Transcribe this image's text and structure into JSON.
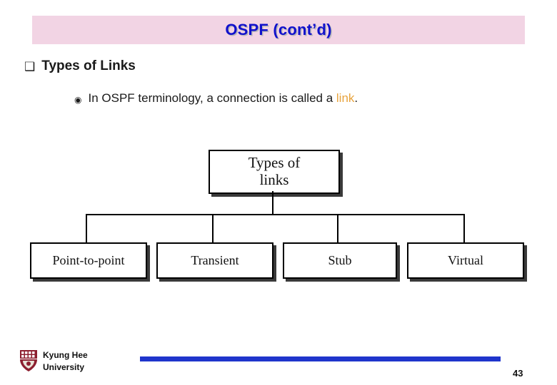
{
  "slide": {
    "title": "OSPF (cont’d)",
    "title_color": "#1111cc",
    "title_bg": "#f2d4e4",
    "bullets": {
      "level1_glyph": "❑",
      "level1_text": "Types of Links",
      "level2_glyph": "◉",
      "level2_text_before": "In OSPF terminology, a connection is called a ",
      "level2_highlight": "link",
      "level2_text_after": ".",
      "highlight_color": "#e8a33d"
    },
    "diagram": {
      "root": "Types of\nlinks",
      "root_line1": "Types of",
      "root_line2": "links",
      "leaves": [
        "Point-to-point",
        "Transient",
        "Stub",
        "Virtual"
      ]
    },
    "footer": {
      "org_line1": "Kyung Hee",
      "org_line2": "University",
      "rule_color": "#1f35cc",
      "page_number": "43"
    }
  }
}
